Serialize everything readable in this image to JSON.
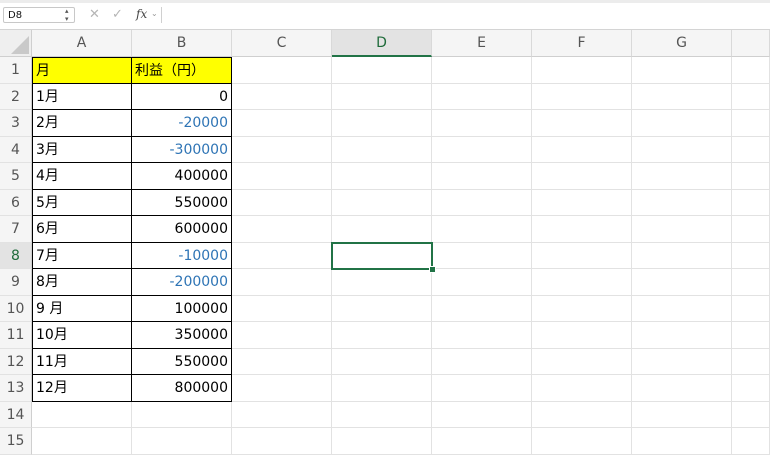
{
  "name_box": "D8",
  "formula_bar": {
    "fx_label": "fx",
    "cancel_icon": "close-icon",
    "confirm_icon": "check-icon",
    "value": ""
  },
  "columns": [
    "A",
    "B",
    "C",
    "D",
    "E",
    "F",
    "G"
  ],
  "selected_column": "D",
  "rows": [
    "1",
    "2",
    "3",
    "4",
    "5",
    "6",
    "7",
    "8",
    "9",
    "10",
    "11",
    "12",
    "13",
    "14",
    "15"
  ],
  "selected_row": "8",
  "table": {
    "header_month": "月",
    "header_profit": "利益（円）",
    "header_fill": "#ffff00",
    "negative_color": "#2e74b5",
    "data": [
      {
        "month": "1月",
        "profit": "0"
      },
      {
        "month": "2月",
        "profit": "-20000"
      },
      {
        "month": "3月",
        "profit": "-300000"
      },
      {
        "month": "4月",
        "profit": "400000"
      },
      {
        "month": "5月",
        "profit": "550000"
      },
      {
        "month": "6月",
        "profit": "600000"
      },
      {
        "month": "7月",
        "profit": "-10000"
      },
      {
        "month": "8月",
        "profit": "-200000"
      },
      {
        "month": "9 月",
        "profit": "100000"
      },
      {
        "month": "10月",
        "profit": "350000"
      },
      {
        "month": "11月",
        "profit": "550000"
      },
      {
        "month": "12月",
        "profit": "800000"
      }
    ]
  }
}
